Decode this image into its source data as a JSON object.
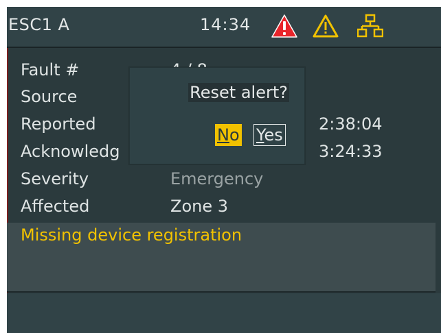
{
  "header": {
    "title": "ESC1 A",
    "time": "14:34",
    "icons": [
      "alarm-triangle-icon",
      "warning-triangle-icon",
      "network-icon"
    ],
    "alarm_color": "#e8252b",
    "warning_color": "#f2c200"
  },
  "fault": {
    "rows": [
      {
        "label": "Fault #",
        "value": "4 / 8"
      },
      {
        "label": "Source",
        "value": ""
      },
      {
        "label": "Reported",
        "value": "2:38:04"
      },
      {
        "label": "Acknowledg",
        "value": "3:24:33"
      },
      {
        "label": "Severity",
        "value": "Emergency"
      },
      {
        "label": "Affected",
        "value": "Zone 3"
      }
    ],
    "message": "Missing device registration"
  },
  "dialog": {
    "question": "Reset alert?",
    "no_label": "No",
    "yes_label": "Yes",
    "no_hotkey": "N",
    "no_rest": "o",
    "yes_hotkey": "Y",
    "yes_rest": "es",
    "selected": "No",
    "highlight_color": "#f2c200"
  },
  "colors": {
    "background": "#2b3a3d",
    "header": "#314347",
    "text": "#e4e8e8",
    "accent": "#f2c200"
  }
}
